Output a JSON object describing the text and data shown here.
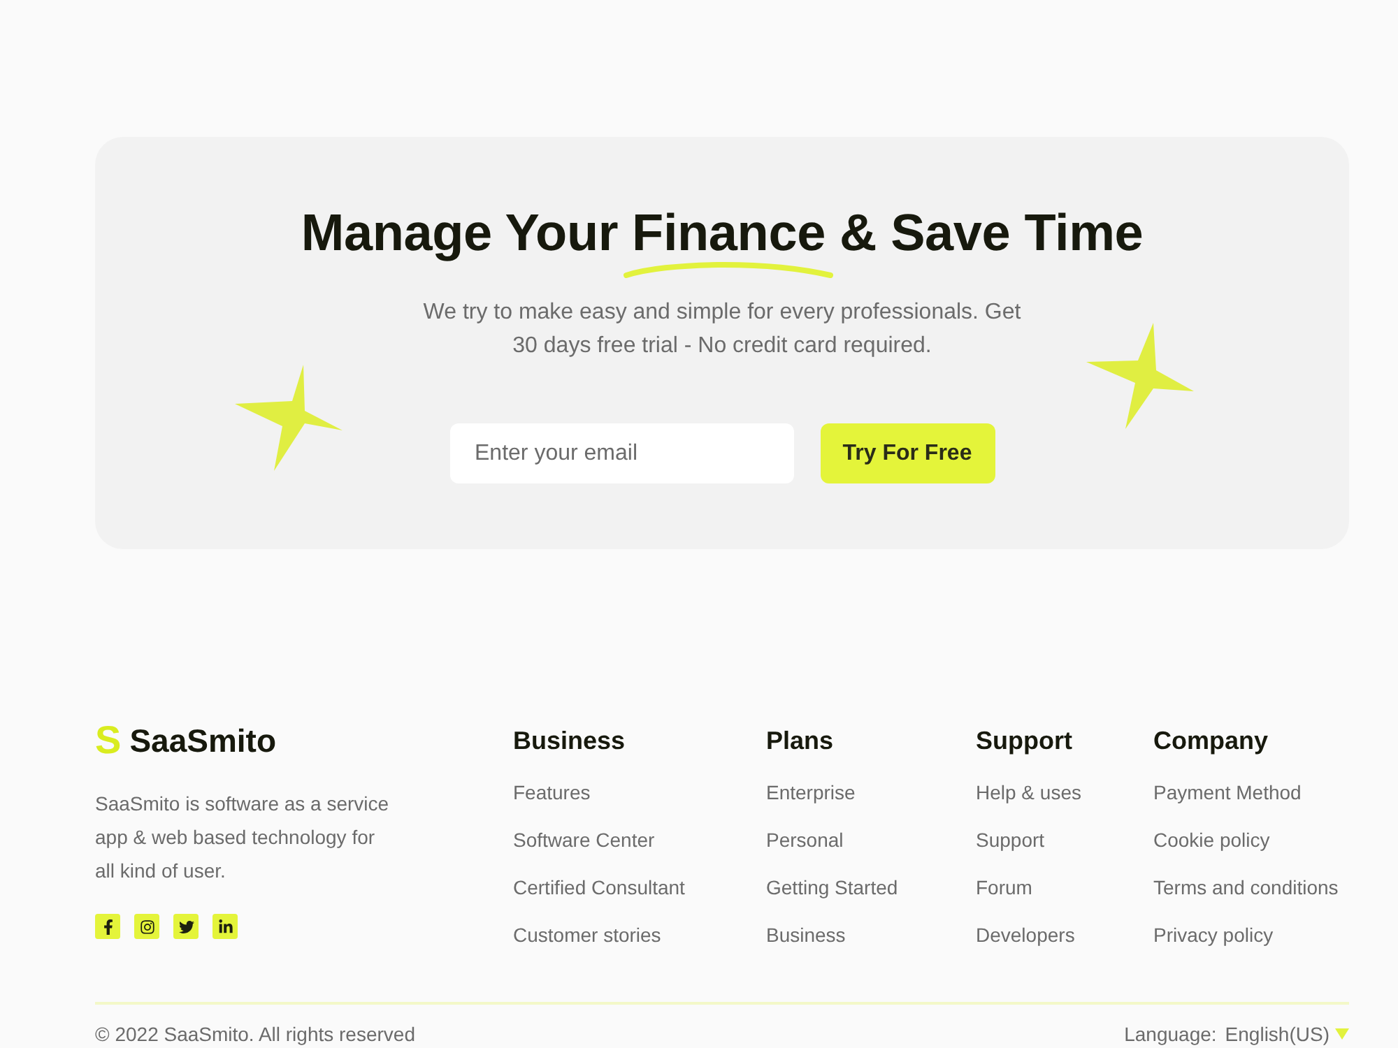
{
  "hero": {
    "headline": {
      "lead": "Manage Your",
      "highlight": "Finance",
      "trail": "& Save Time"
    },
    "subtitle": "We try to make easy and simple for every professionals. Get 30 days free trial - No credit card required.",
    "email_field": {
      "placeholder": "Enter your email"
    },
    "cta_button": "Try For Free"
  },
  "footer": {
    "brand": {
      "mark": "S",
      "name": "SaaSmito",
      "description": "SaaSmito is software as a service app & web based technology for all kind of user.",
      "social": [
        {
          "kind": "facebook"
        },
        {
          "kind": "instagram"
        },
        {
          "kind": "twitter"
        },
        {
          "kind": "linkedin"
        }
      ]
    },
    "columns": [
      {
        "title": "Business",
        "links": [
          "Features",
          "Software Center",
          "Certified Consultant",
          "Customer stories"
        ]
      },
      {
        "title": "Plans",
        "links": [
          "Enterprise",
          "Personal",
          "Getting Started",
          "Business"
        ]
      },
      {
        "title": "Support",
        "links": [
          "Help & uses",
          "Support",
          "Forum",
          "Developers"
        ]
      },
      {
        "title": "Company",
        "links": [
          "Payment Method",
          "Cookie policy",
          "Terms and conditions",
          "Privacy policy"
        ]
      }
    ],
    "copyright": "© 2022 SaaSmito. All rights reserved",
    "language": {
      "label": "Language:",
      "value": "English(US)"
    }
  }
}
